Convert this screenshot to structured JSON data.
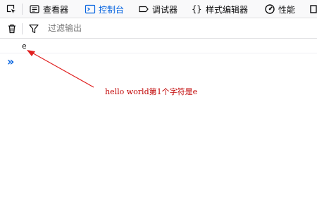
{
  "toolbar": {
    "tabs": [
      {
        "label": "查看器",
        "icon": "inspector-icon"
      },
      {
        "label": "控制台",
        "icon": "console-icon",
        "selected": true
      },
      {
        "label": "调试器",
        "icon": "debugger-icon"
      },
      {
        "label": "样式编辑器",
        "icon": "style-editor-icon"
      },
      {
        "label": "性能",
        "icon": "performance-icon"
      }
    ],
    "accent_color": "#0060df"
  },
  "filter": {
    "placeholder": "过滤输出"
  },
  "console": {
    "output": "e",
    "prompt_symbol": "»"
  },
  "annotation": {
    "text": "hello world第1个字符是e",
    "color": "#c00000"
  }
}
